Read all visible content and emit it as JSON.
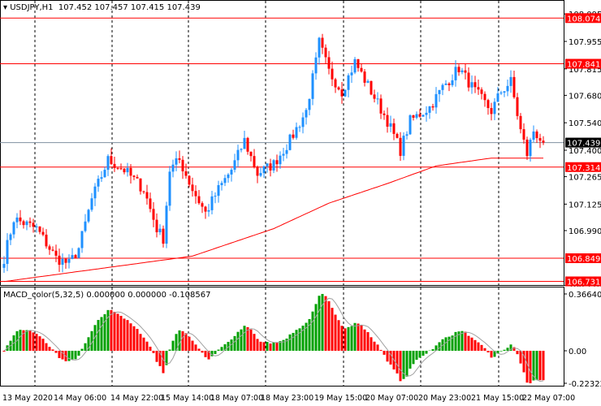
{
  "header": {
    "symbol": "USDJPY,H1",
    "ohlc": "107.452 107.457 107.415 107.439"
  },
  "macd": {
    "label": "MACD_color(5,32,5) 0.000000 0.000000 -0.108567",
    "axis": [
      "0.366406",
      "0.00",
      "-0.22322"
    ]
  },
  "colors": {
    "bull": "#1e90ff",
    "bear": "#ff0000",
    "macd_up": "#00a000",
    "macd_down": "#ff0000",
    "ma": "#ff0000",
    "level": "#ff0000"
  },
  "chart_data": {
    "type": "candlestick",
    "price_axis": [
      "108.095",
      "107.955",
      "107.815",
      "107.680",
      "107.540",
      "107.400",
      "107.265",
      "107.125",
      "106.990",
      "106.710"
    ],
    "levels": [
      "108.074",
      "107.841",
      "107.314",
      "106.849",
      "106.731"
    ],
    "current_price": "107.439",
    "time_labels": [
      "13 May 2020",
      "14 May 06:00",
      "14 May 22:00",
      "15 May 14:00",
      "18 May 07:00",
      "18 May 23:00",
      "19 May 15:00",
      "20 May 07:00",
      "20 May 23:00",
      "21 May 15:00",
      "22 May 07:00"
    ],
    "price_path": [
      [
        0,
        106.85
      ],
      [
        3,
        107.05
      ],
      [
        10,
        107.0
      ],
      [
        16,
        106.85
      ],
      [
        20,
        106.82
      ],
      [
        23,
        106.9
      ],
      [
        27,
        107.15
      ],
      [
        32,
        107.35
      ],
      [
        37,
        107.3
      ],
      [
        43,
        107.2
      ],
      [
        47,
        107.0
      ],
      [
        49,
        106.95
      ],
      [
        51,
        107.3
      ],
      [
        54,
        107.35
      ],
      [
        58,
        107.2
      ],
      [
        62,
        107.08
      ],
      [
        66,
        107.2
      ],
      [
        70,
        107.3
      ],
      [
        74,
        107.45
      ],
      [
        78,
        107.28
      ],
      [
        83,
        107.33
      ],
      [
        88,
        107.45
      ],
      [
        93,
        107.6
      ],
      [
        96,
        107.85
      ],
      [
        97,
        107.95
      ],
      [
        100,
        107.8
      ],
      [
        104,
        107.7
      ],
      [
        108,
        107.85
      ],
      [
        113,
        107.7
      ],
      [
        118,
        107.55
      ],
      [
        122,
        107.4
      ],
      [
        125,
        107.55
      ],
      [
        131,
        107.62
      ],
      [
        135,
        107.72
      ],
      [
        140,
        107.82
      ],
      [
        145,
        107.7
      ],
      [
        150,
        107.6
      ],
      [
        153,
        107.7
      ],
      [
        156,
        107.75
      ],
      [
        159,
        107.5
      ],
      [
        161,
        107.38
      ],
      [
        163,
        107.5
      ],
      [
        166,
        107.44
      ]
    ],
    "ma_path": [
      [
        0,
        106.73
      ],
      [
        58,
        106.86
      ],
      [
        83,
        107.0
      ],
      [
        100,
        107.13
      ],
      [
        118,
        107.23
      ],
      [
        133,
        107.32
      ],
      [
        150,
        107.36
      ],
      [
        167,
        107.36
      ]
    ]
  }
}
